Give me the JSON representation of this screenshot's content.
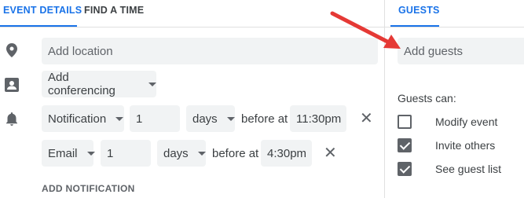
{
  "tabs": {
    "event_details": "EVENT DETAILS",
    "find_a_time": "FIND A TIME",
    "guests": "GUESTS"
  },
  "location": {
    "placeholder": "Add location"
  },
  "conferencing": {
    "label": "Add conferencing"
  },
  "notifications": [
    {
      "type": "Notification",
      "amount": "1",
      "unit": "days",
      "before_at": "before at",
      "time": "11:30pm"
    },
    {
      "type": "Email",
      "amount": "1",
      "unit": "days",
      "before_at": "before at",
      "time": "4:30pm"
    }
  ],
  "add_notification": "ADD NOTIFICATION",
  "guests": {
    "placeholder": "Add guests",
    "can_label": "Guests can:",
    "permissions": [
      {
        "label": "Modify event",
        "checked": false
      },
      {
        "label": "Invite others",
        "checked": true
      },
      {
        "label": "See guest list",
        "checked": true
      }
    ]
  },
  "colors": {
    "accent": "#1a73e8",
    "annotation_arrow": "#e53935"
  },
  "icons": [
    "location-pin-icon",
    "conferencing-icon",
    "bell-icon",
    "close-icon",
    "dropdown-caret-icon"
  ]
}
